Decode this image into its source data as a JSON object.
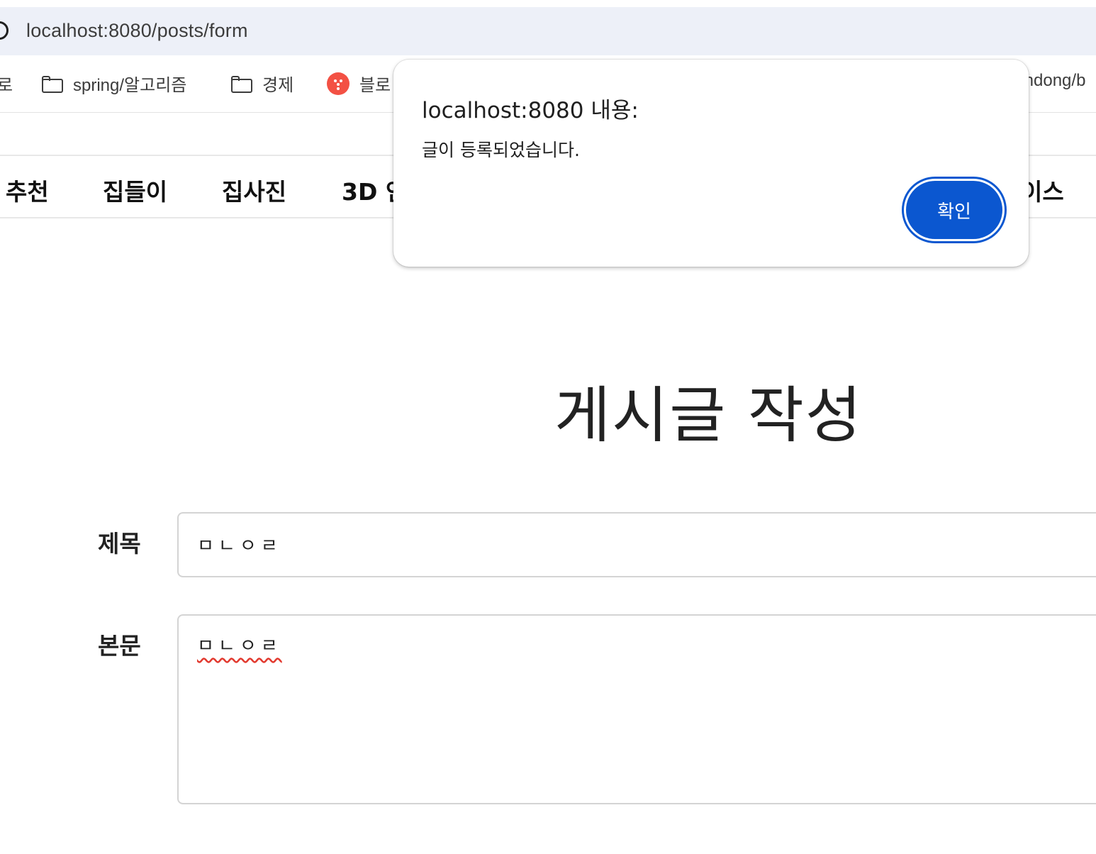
{
  "browser": {
    "url": "localhost:8080/posts/form",
    "bookmarks": [
      {
        "label": "spring/알고리즘",
        "icon": "folder-icon"
      },
      {
        "label": "경제",
        "icon": "folder-icon"
      },
      {
        "label": "블로",
        "icon": "blog-icon"
      },
      {
        "label": "ındong/b",
        "icon": "none"
      }
    ],
    "bookmark_left_fragment": "로"
  },
  "nav": {
    "items": [
      "추천",
      "집들이",
      "집사진",
      "3D 인",
      "이스"
    ]
  },
  "page": {
    "title": "게시글 작성",
    "form": {
      "title_label": "제목",
      "title_value": "ㅁㄴㅇㄹ",
      "body_label": "본문",
      "body_value": "ㅁㄴㅇㄹ"
    }
  },
  "dialog": {
    "title": "localhost:8080 내용:",
    "message": "글이 등록되었습니다.",
    "ok_label": "확인",
    "accent_color": "#0b57d0"
  }
}
